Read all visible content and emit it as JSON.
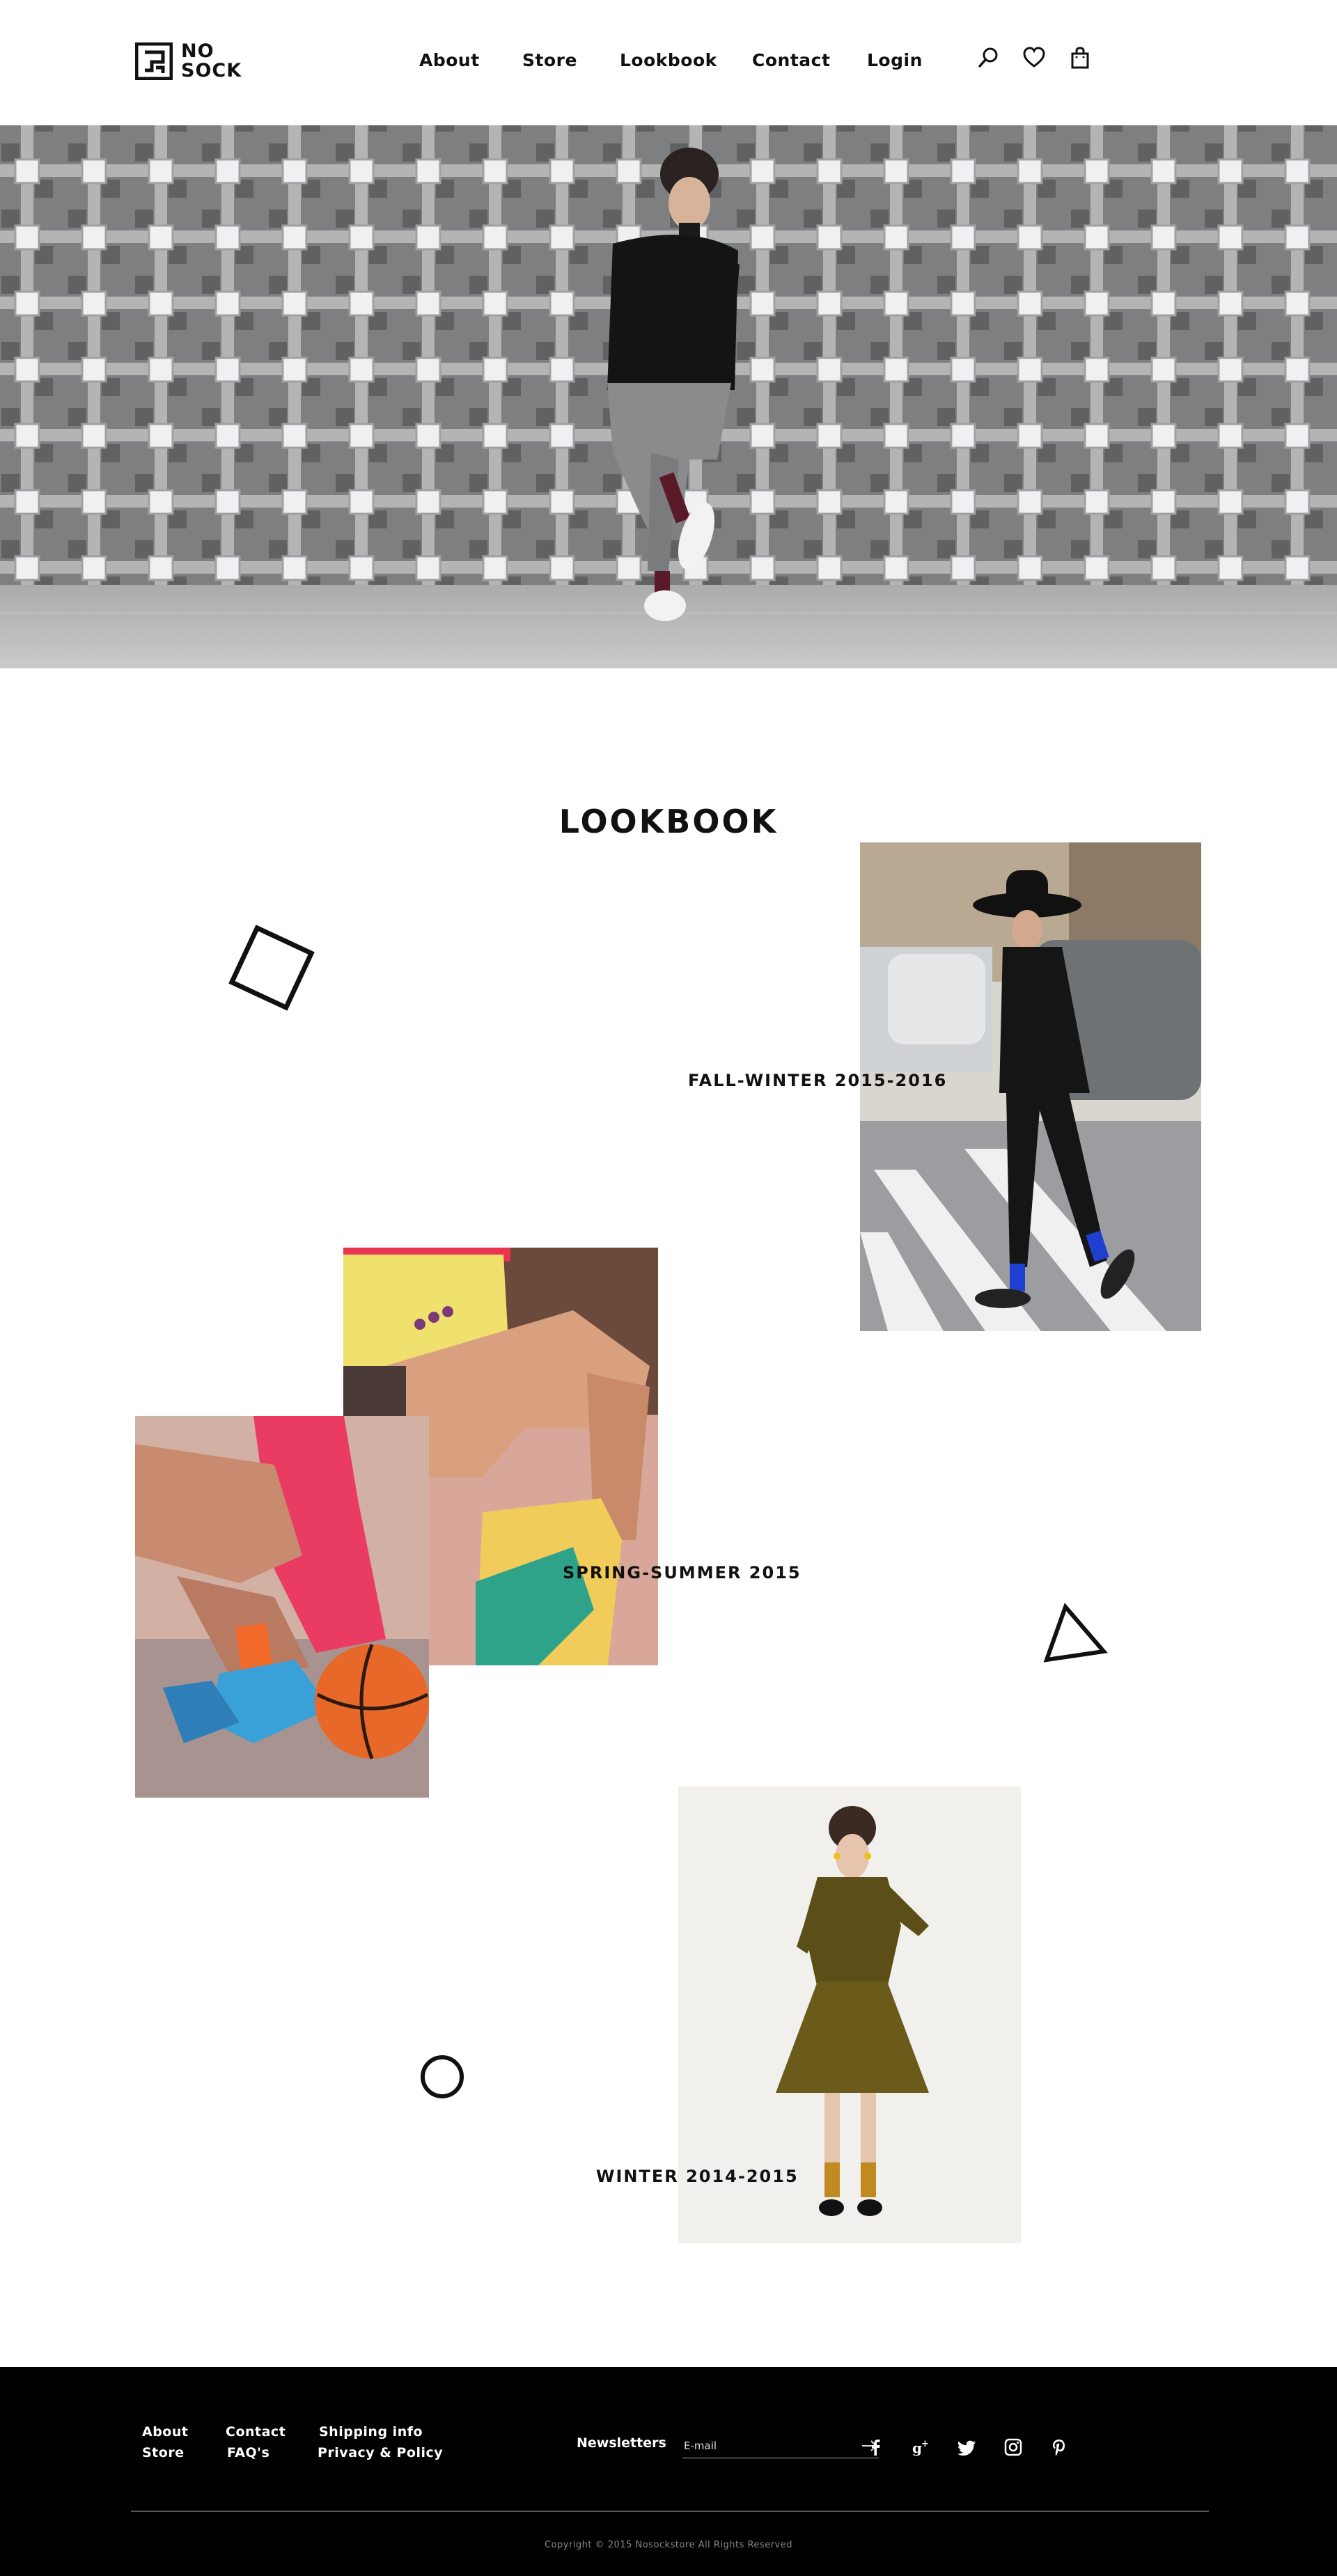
{
  "brand": {
    "line1": "NO",
    "line2": "SOCK"
  },
  "nav": {
    "items": [
      "About",
      "Store",
      "Lookbook",
      "Contact",
      "Login"
    ]
  },
  "header_icons": [
    "search-icon",
    "heart-icon",
    "shopping-bag-icon"
  ],
  "lookbook": {
    "title": "LOOKBOOK",
    "collections": [
      {
        "caption": "FALL-WINTER 2015-2016"
      },
      {
        "caption": "SPRING-SUMMER 2015"
      },
      {
        "caption": "WINTER 2014-2015"
      }
    ]
  },
  "footer": {
    "col1": [
      "About",
      "Store"
    ],
    "col2": [
      "Contact",
      "FAQ's"
    ],
    "col3": [
      "Shipping info",
      "Privacy & Policy"
    ],
    "newsletter_label": "Newsletters",
    "email_placeholder": "E-mail",
    "socials": [
      "facebook-icon",
      "google-plus-icon",
      "twitter-icon",
      "instagram-icon",
      "pinterest-icon"
    ],
    "copyright": "Copyright © 2015 Nosockstore All Rights Reserved"
  },
  "colors": {
    "footer_bg": "#000000",
    "text": "#111111",
    "sock_blue": "#1f3fd1",
    "sock_orange": "#f26a2a"
  }
}
